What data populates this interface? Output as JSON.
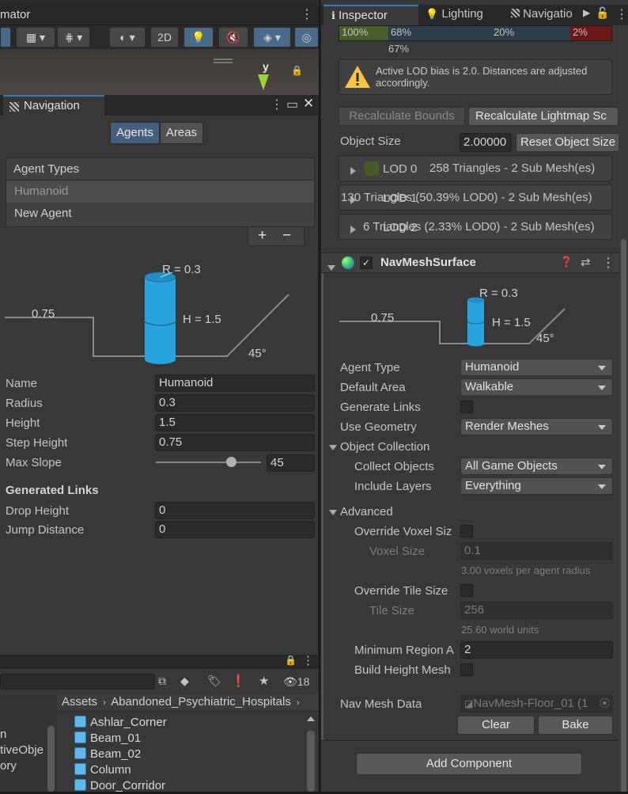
{
  "scene": {
    "tab_label": "mator",
    "axis_label": "y",
    "toolbar_2d": "2D"
  },
  "navigation": {
    "title": "Navigation",
    "tabs": [
      "Agents",
      "Areas"
    ],
    "agent_types_header": "Agent Types",
    "agent_types": [
      "Humanoid",
      "New Agent"
    ],
    "add_symbol": "+",
    "remove_symbol": "−",
    "diagram": {
      "radius": "R = 0.3",
      "height": "H = 1.5",
      "step": "0.75",
      "slope": "45°"
    },
    "fields": [
      {
        "label": "Name",
        "value": "Humanoid"
      },
      {
        "label": "Radius",
        "value": "0.3"
      },
      {
        "label": "Height",
        "value": "1.5"
      },
      {
        "label": "Step Height",
        "value": "0.75"
      }
    ],
    "max_slope": {
      "label": "Max Slope",
      "value": "45",
      "fraction": 0.714
    },
    "generated_links_header": "Generated Links",
    "links": [
      {
        "label": "Drop Height",
        "value": "0"
      },
      {
        "label": "Jump Distance",
        "value": "0"
      }
    ]
  },
  "project": {
    "count": "18",
    "breadcrumb": [
      "Assets",
      "Abandoned_Psychiatric_Hospitals"
    ],
    "left_items": [
      "n",
      "tiveObje",
      "ory"
    ],
    "assets": [
      "Ashlar_Corner",
      "Beam_01",
      "Beam_02",
      "Column",
      "Door_Corridor"
    ]
  },
  "inspector": {
    "tabs": [
      "Inspector",
      "Lighting",
      "Navigatio"
    ],
    "lod_bar": [
      {
        "label": "100%",
        "color": "#4a5d2a"
      },
      {
        "label": "68%",
        "color": "#2b3e4a"
      },
      {
        "label": "20%",
        "color": "#2b3e4a"
      },
      {
        "label": "2%",
        "color": "#6a1818"
      }
    ],
    "lod_bar_below": "67%",
    "warning": "Active LOD bias is 2.0. Distances are adjusted accordingly.",
    "recalc_bounds": "Recalculate Bounds",
    "recalc_lightmap": "Recalculate Lightmap Sc",
    "object_size_label": "Object Size",
    "object_size_value": "2.00000",
    "reset_object_size": "Reset Object Size",
    "lods": [
      {
        "name": "LOD 0",
        "info": "258 Triangles  - 2 Sub Mesh(es)"
      },
      {
        "name": "LOD 1",
        "info": "130 Triangles (50.39% LOD0) - 2 Sub Mesh(es)"
      },
      {
        "name": "LOD 2",
        "info": "6 Triangles (2.33% LOD0) - 2 Sub Mesh(es)"
      }
    ],
    "component_title": "NavMeshSurface",
    "diagram": {
      "radius": "R = 0.3",
      "height": "H = 1.5",
      "step": "0.75",
      "slope": "45°"
    },
    "agent_type": {
      "label": "Agent Type",
      "value": "Humanoid"
    },
    "default_area": {
      "label": "Default Area",
      "value": "Walkable"
    },
    "generate_links": {
      "label": "Generate Links"
    },
    "use_geometry": {
      "label": "Use Geometry",
      "value": "Render Meshes"
    },
    "object_collection": "Object Collection",
    "collect_objects": {
      "label": "Collect Objects",
      "value": "All Game Objects"
    },
    "include_layers": {
      "label": "Include Layers",
      "value": "Everything"
    },
    "advanced": "Advanced",
    "override_voxel": {
      "label": "Override Voxel Siz"
    },
    "voxel_size": {
      "label": "Voxel Size",
      "value": "0.1",
      "hint": "3.00 voxels per agent radius"
    },
    "override_tile": {
      "label": "Override Tile Size"
    },
    "tile_size": {
      "label": "Tile Size",
      "value": "256",
      "hint": "25.60 world units"
    },
    "min_region": {
      "label": "Minimum Region A",
      "value": "2"
    },
    "build_height": {
      "label": "Build Height Mesh"
    },
    "navmesh_data": {
      "label": "Nav Mesh Data",
      "value": "NavMesh-Floor_01 (1"
    },
    "clear": "Clear",
    "bake": "Bake",
    "add_component": "Add Component"
  }
}
